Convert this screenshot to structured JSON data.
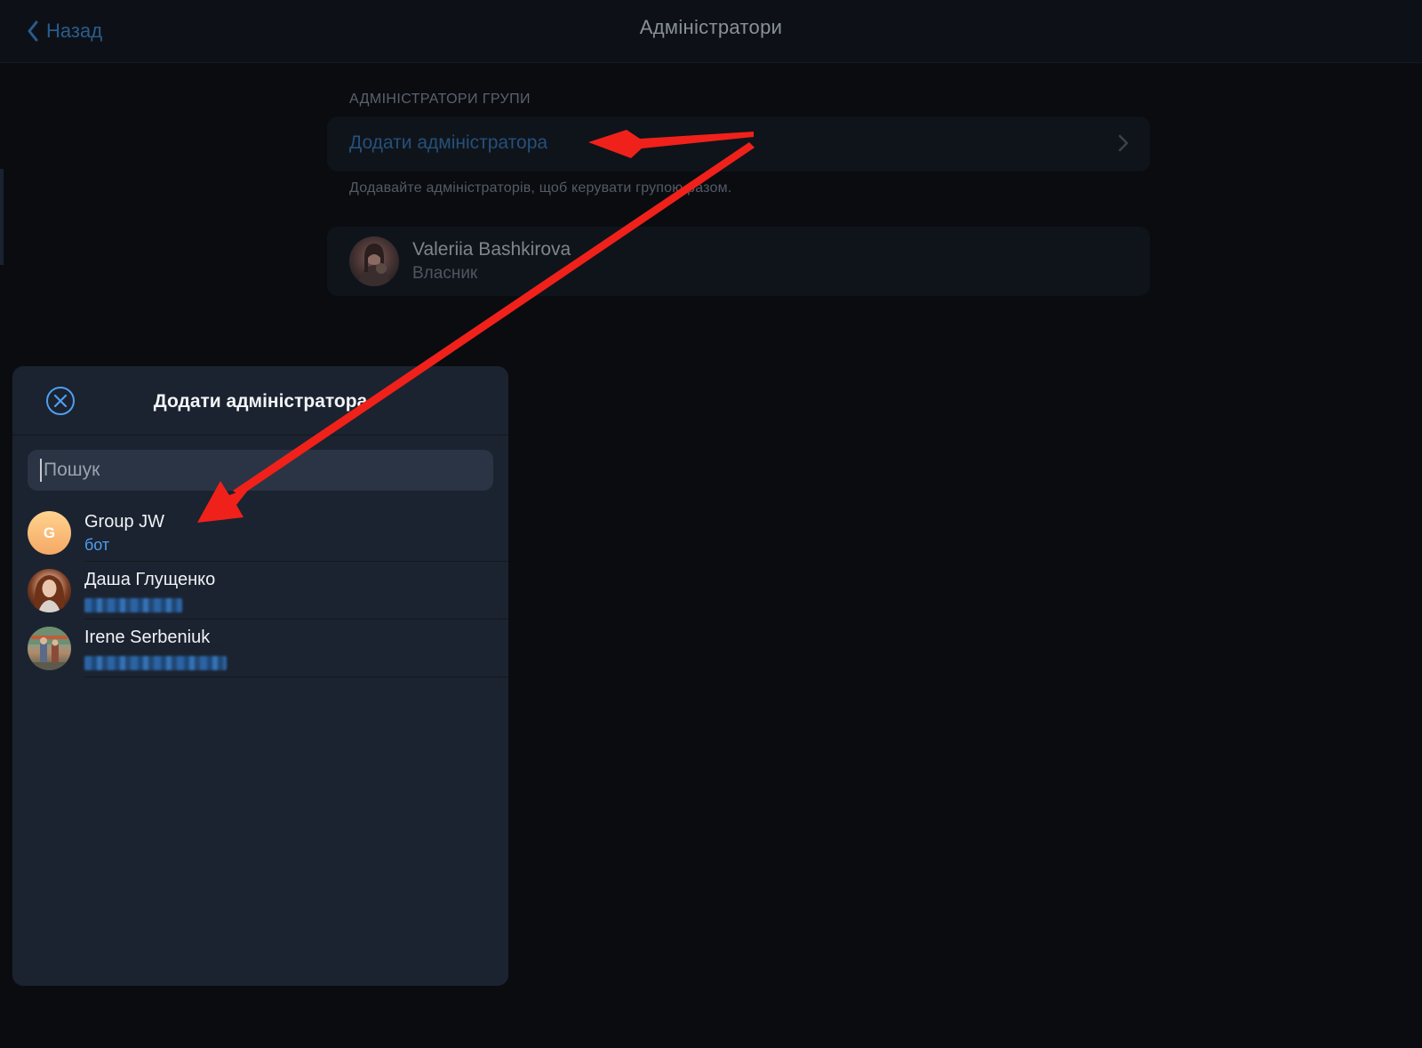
{
  "navbar": {
    "back_label": "Назад",
    "title": "Адміністратори"
  },
  "admins_section": {
    "header": "АДМІНІСТРАТОРИ ГРУПИ",
    "add_admin_label": "Додати адміністратора",
    "footer": "Додавайте адміністраторів, щоб керувати групою разом.",
    "owner": {
      "name": "Valeriia Bashkirova",
      "role": "Власник"
    }
  },
  "modal": {
    "title": "Додати адміністратора",
    "search": {
      "placeholder": "Пошук",
      "value": ""
    },
    "contacts": [
      {
        "name": "Group JW",
        "subtitle": "бот",
        "avatar_letter": "G",
        "avatar": "letter-avatar"
      },
      {
        "name": "Даша Глущенко",
        "subtitle": "",
        "avatar": "photo-avatar",
        "status_blurred": true
      },
      {
        "name": "Irene Serbeniuk",
        "subtitle": "",
        "avatar": "photo-avatar",
        "status_blurred": true
      }
    ]
  },
  "icons": {
    "back": "chevron-left-icon",
    "row_chevron": "chevron-right-icon",
    "close": "close-circle-icon"
  },
  "colors": {
    "background": "#0a0c10",
    "modal_background": "#1b2330",
    "accent": "#4f9ef0",
    "annotation_arrow": "#f0211a"
  }
}
